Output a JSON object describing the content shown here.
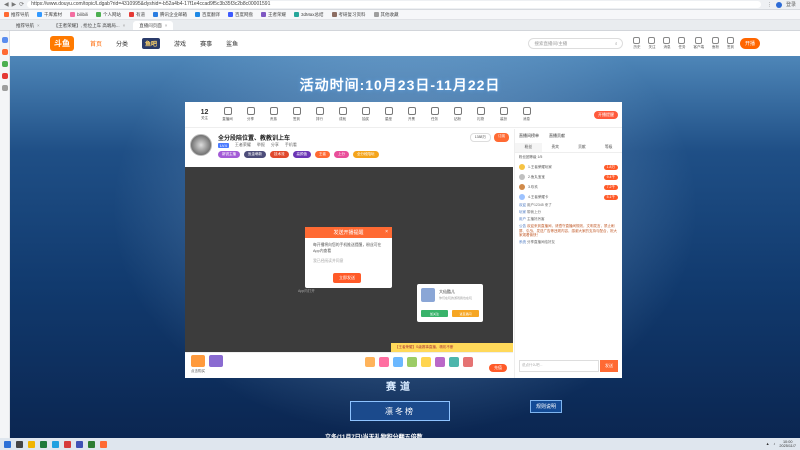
{
  "browser": {
    "url": "https://www.douyu.com/topic/Ldgab?rid=4310995&dyshid=-b52a4b4-17f1e4ccad9f5c3b35f3c2b8c00001591",
    "bookmarks": [
      "推荐导航",
      "千库素材",
      "bilibili",
      "个人网站",
      "有道",
      "腾讯企业邮箱",
      "百度翻译",
      "百度网盘",
      "王者荣耀",
      "3dMax总结",
      "考研复习资料",
      "其他收藏"
    ],
    "tabs": [
      {
        "label": "推荐导航",
        "active": false
      },
      {
        "label": "【王者荣耀】, 抢位上车 高端局... ",
        "active": false
      },
      {
        "label": "直播间页面",
        "active": true
      }
    ],
    "right_labels": [
      "1",
      "登录"
    ]
  },
  "site": {
    "logo": "斗鱼",
    "nav": [
      "首页",
      "分类",
      "鱼吧",
      "游戏",
      "赛事",
      "鲨鱼"
    ],
    "active_nav": "首页",
    "search_placeholder": "搜索直播间/主播",
    "header_icons": [
      "历史",
      "关注",
      "消息",
      "任务",
      "客户端",
      "鱼粉",
      "签到"
    ],
    "open_button": "开播"
  },
  "event": {
    "title": "活动时间:10月23日-11月22日",
    "banner_text": "赛道",
    "rank_button": "凛冬榜",
    "rules_button": "规则说明",
    "ticker": "立冬(11月7日)当天礼物积分翻五倍数"
  },
  "room": {
    "toolbar": [
      {
        "label": "关注",
        "num": "12"
      },
      {
        "label": "直播间"
      },
      {
        "label": "分享"
      },
      {
        "label": "贵族"
      },
      {
        "label": "签到"
      },
      {
        "label": "排行"
      },
      {
        "label": "成就"
      },
      {
        "label": "抽奖"
      },
      {
        "label": "星座"
      },
      {
        "label": "开黑"
      },
      {
        "label": "任务"
      },
      {
        "label": "钻粉"
      },
      {
        "label": "礼物"
      },
      {
        "label": "装扮"
      },
      {
        "label": "消息"
      }
    ],
    "toolbar_badge": "开播提醒",
    "anchor_title": "全分段陪位置、教教训上车",
    "anchor_sub": [
      "王者荣耀",
      "举报",
      "分享",
      "手机看"
    ],
    "level": "LV4",
    "tags": [
      "新锐主播",
      "氪金萌新",
      "技术流",
      "高颜值",
      "王者",
      "上分",
      "全分段陪玩"
    ],
    "follow_btns": [
      "1388万",
      "订阅"
    ],
    "popup": {
      "header": "发送开播提醒",
      "body": "每开播将向您的手机推送提醒，粉丝可在App内查看",
      "checkbox": "我已经阅读并同意",
      "button": "立即发送"
    },
    "friend": {
      "name": "大仙酷儿",
      "sub": "你们在玩的游戏我也在玩",
      "btn1": "加关注",
      "btn2": "进直播间"
    },
    "promo": "【王者荣耀】S级赛事直播，精彩不断",
    "tooltip_text": "App内打开",
    "gift_tip": "点击购买",
    "charge": "充值",
    "input_placeholder": "说点什么吧...",
    "send": "发送"
  },
  "sidebar": {
    "header": [
      "直播间榜单",
      "直播贡献"
    ],
    "tabs": [
      "粉丝",
      "贵宾",
      "贡献",
      "等级"
    ],
    "rows": [
      {
        "text": "粉丝团等级 1/5",
        "pill": "",
        "color": "#f6c343"
      },
      {
        "text": "1.王者荣耀玩家",
        "pill": "1.8万",
        "color": "#f6c343"
      },
      {
        "text": "2.鱼丸宝宝",
        "pill": "9.4千",
        "color": "#c0c0c0"
      },
      {
        "text": "3.玖玖",
        "pill": "7.2千",
        "color": "#d08a4a"
      },
      {
        "text": "4.王者荣耀卡",
        "pill": "5.1千",
        "color": "#9cc2ff"
      }
    ],
    "chat": [
      {
        "name": "欢迎",
        "text": "用户12345 来了",
        "type": "normal"
      },
      {
        "name": "玩家",
        "text": "带我上分",
        "type": "normal"
      },
      {
        "name": "用户",
        "text": "主播好厉害",
        "type": "normal"
      },
      {
        "name": "公告",
        "text": "欢迎来到直播间，请遵守直播间规则，文明发言，禁止刷屏、引战、发送广告等违规内容，感谢大家的支持与配合，祝大家观看愉快！",
        "type": "long"
      },
      {
        "name": "系统",
        "text": "分享直播间给好友",
        "type": "normal"
      }
    ]
  },
  "taskbar": {
    "time": "10:00",
    "date": "2025/11/7"
  }
}
